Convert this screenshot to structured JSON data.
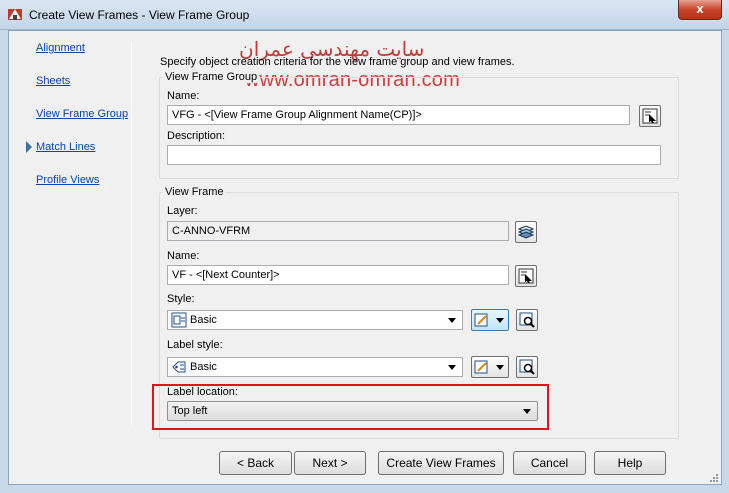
{
  "window": {
    "title": "Create View Frames - View Frame Group",
    "close_glyph": "x"
  },
  "watermark": {
    "line1": "سایت مهندسی عمران",
    "line2": "www.omran-omran.com"
  },
  "nav": {
    "items": [
      {
        "label": "Alignment"
      },
      {
        "label": "Sheets"
      },
      {
        "label": "View Frame Group"
      },
      {
        "label": "Match Lines"
      },
      {
        "label": "Profile Views"
      }
    ],
    "current": "View Frame Group"
  },
  "intro": "Specify object creation criteria for the view frame group and view frames.",
  "view_frame_group": {
    "title": "View Frame Group",
    "name_label": "Name:",
    "name_value": "VFG - <[View Frame Group Alignment Name(CP)]>",
    "description_label": "Description:",
    "description_value": ""
  },
  "view_frame": {
    "title": "View Frame",
    "layer_label": "Layer:",
    "layer_value": "C-ANNO-VFRM",
    "name_label": "Name:",
    "name_value": "VF - <[Next Counter]>",
    "style_label": "Style:",
    "style_value": "Basic",
    "label_style_label": "Label style:",
    "label_style_value": "Basic",
    "label_location_label": "Label location:",
    "label_location_value": "Top left"
  },
  "buttons": {
    "back": "< Back",
    "next": "Next >",
    "create": "Create View Frames",
    "cancel": "Cancel",
    "help": "Help"
  },
  "colors": {
    "highlight": "#e0141e",
    "link": "#0645ad",
    "watermark": "#c23a3a"
  }
}
